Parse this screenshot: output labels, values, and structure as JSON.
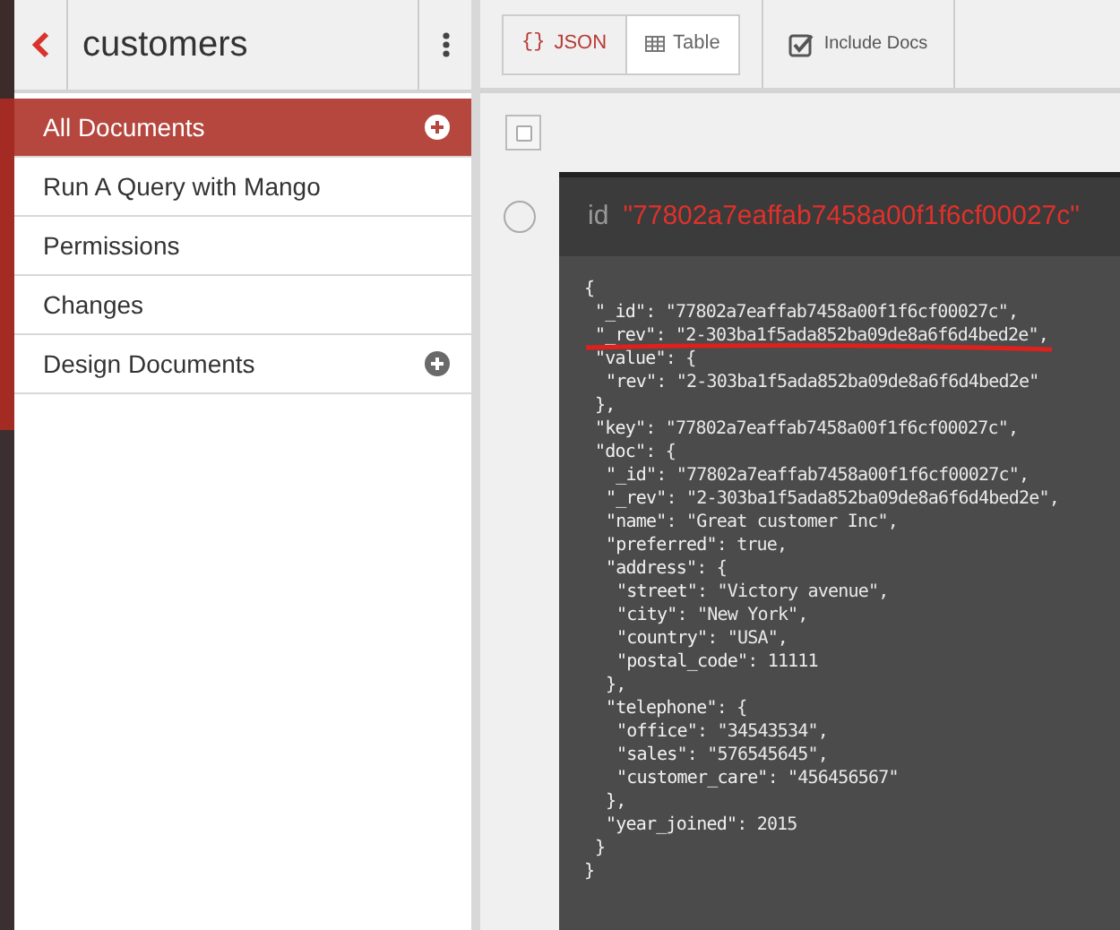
{
  "header": {
    "title": "customers"
  },
  "view_toggle": [
    {
      "label": "JSON",
      "icon": "{}",
      "selected": true
    },
    {
      "label": "Table",
      "selected": false
    }
  ],
  "include_docs": {
    "label": "Include Docs",
    "checked": true
  },
  "sidebar": {
    "items": [
      {
        "label": "All Documents",
        "selected": true,
        "add": true
      },
      {
        "label": "Run A Query with Mango",
        "selected": false,
        "add": false
      },
      {
        "label": "Permissions",
        "selected": false,
        "add": false
      },
      {
        "label": "Changes",
        "selected": false,
        "add": false
      },
      {
        "label": "Design Documents",
        "selected": false,
        "add": true
      }
    ]
  },
  "select_all": {
    "checked": false
  },
  "document": {
    "selected": false,
    "id_label": "id",
    "id": "\"77802a7eaffab7458a00f1f6cf00027c\"",
    "lines": [
      {
        "key": "{",
        "children": [
          {
            "key": "\"_id\"",
            "rest": ": \"77802a7eaffab7458a00f1f6cf00027c\","
          },
          {
            "key": "\"_rev\"",
            "rest": ": \"2-303ba1f5ada852ba09de8a6f6d4bed2e\",",
            "underlined": true
          },
          {
            "key": "\"value\"",
            "rest": ": {",
            "children": [
              {
                "key": "\"rev\"",
                "rest": ": \"2-303ba1f5ada852ba09de8a6f6d4bed2e\""
              }
            ]
          },
          {
            "key": "},"
          },
          {
            "key": "\"key\"",
            "rest": ": \"77802a7eaffab7458a00f1f6cf00027c\","
          },
          {
            "key": "\"doc\"",
            "rest": ": {",
            "children": [
              {
                "key": "\"_id\"",
                "rest": ": \"77802a7eaffab7458a00f1f6cf00027c\","
              },
              {
                "key": "\"_rev\"",
                "rest": ": \"2-303ba1f5ada852ba09de8a6f6d4bed2e\","
              },
              {
                "key": "\"name\"",
                "rest": ": \"Great customer Inc\","
              },
              {
                "key": "\"preferred\"",
                "rest": ": true,"
              },
              {
                "key": "\"address\"",
                "rest": ": {",
                "children": [
                  {
                    "key": "\"street\"",
                    "rest": ": \"Victory avenue\","
                  },
                  {
                    "key": "\"city\"",
                    "rest": ": \"New York\","
                  },
                  {
                    "key": "\"country\"",
                    "rest": ": \"USA\","
                  },
                  {
                    "key": "\"postal_code\"",
                    "rest": ": 11111"
                  }
                ]
              },
              {
                "key": "},"
              },
              {
                "key": "\"telephone\"",
                "rest": ": {",
                "children": [
                  {
                    "key": "\"office\"",
                    "rest": ": \"34543534\","
                  },
                  {
                    "key": "\"sales\"",
                    "rest": ": \"576545645\","
                  },
                  {
                    "key": "\"customer_care\"",
                    "rest": ": \"456456567\""
                  }
                ]
              },
              {
                "key": "},"
              },
              {
                "key": "\"year_joined\"",
                "rest": ": 2015"
              }
            ]
          },
          {
            "key": "}"
          }
        ]
      },
      {
        "key": "}"
      }
    ]
  }
}
